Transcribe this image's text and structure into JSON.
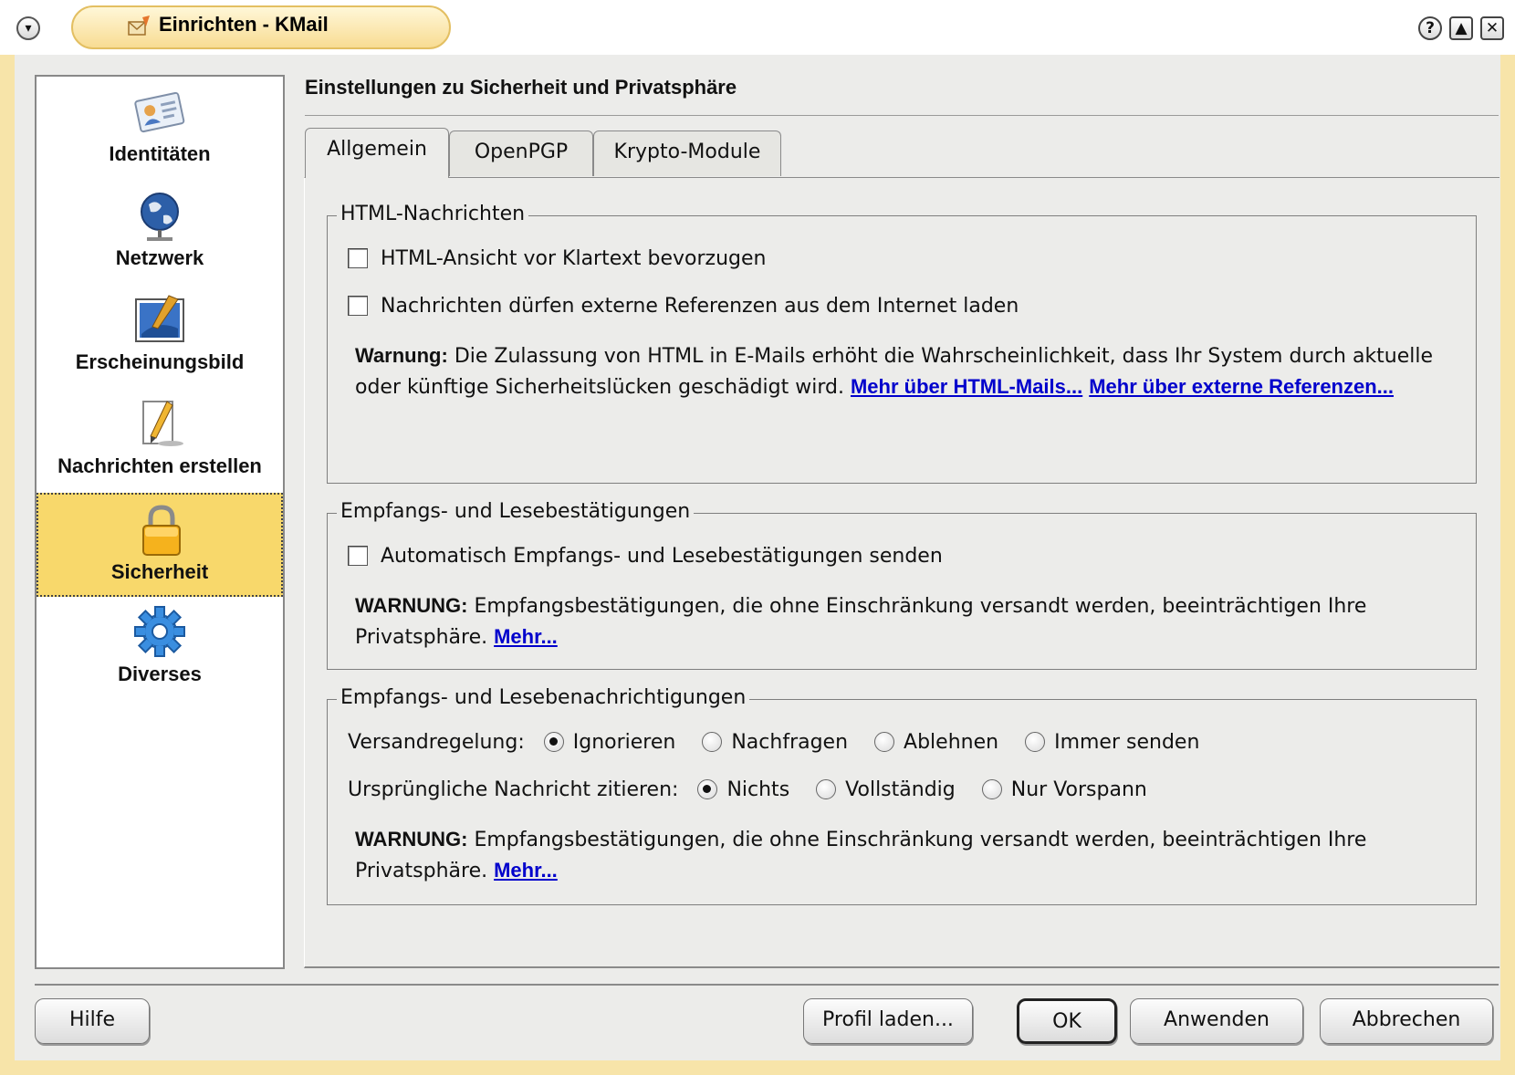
{
  "window": {
    "title": "Einrichten - KMail",
    "buttons": {
      "help": "?",
      "shade": "▲",
      "close": "✕"
    }
  },
  "sidebar": {
    "items": [
      {
        "label": "Identitäten",
        "icon": "identity-card-icon"
      },
      {
        "label": "Netzwerk",
        "icon": "globe-network-icon"
      },
      {
        "label": "Erscheinungsbild",
        "icon": "appearance-brush-icon"
      },
      {
        "label": "Nachrichten erstellen",
        "icon": "compose-pencil-icon"
      },
      {
        "label": "Sicherheit",
        "icon": "padlock-icon",
        "selected": true
      },
      {
        "label": "Diverses",
        "icon": "gear-icon"
      }
    ]
  },
  "page_title": "Einstellungen zu Sicherheit und Privatsphäre",
  "tabs": [
    {
      "label": "Allgemein",
      "active": true
    },
    {
      "label": "OpenPGP"
    },
    {
      "label": "Krypto-Module"
    }
  ],
  "html_group": {
    "title": "HTML-Nachrichten",
    "check_html": "HTML-Ansicht vor Klartext bevorzugen",
    "check_external": "Nachrichten dürfen externe Referenzen aus dem Internet laden",
    "warning_label": "Warnung:",
    "warning_line1": "Die Zulassung von HTML in E-Mails erhöht die Wahrscheinlichkeit, dass Ihr System durch aktuelle",
    "warning_line2": "oder künftige Sicherheitslücken geschädigt wird.",
    "link_html": "Mehr über HTML-Mails...",
    "link_external": "Mehr über externe Referenzen..."
  },
  "receipt_group": {
    "title": "Empfangs- und Lesebestätigungen",
    "check_auto": "Automatisch Empfangs- und Lesebestätigungen senden",
    "warning_label": "WARNUNG:",
    "warning_line1": "Empfangsbestätigungen, die ohne Einschränkung versandt werden, beeinträchtigen Ihre",
    "warning_line2": "Privatsphäre.",
    "link_more": "Mehr..."
  },
  "notification_group": {
    "title": "Empfangs- und Lesebenachrichtigungen",
    "policy_label": "Versandregelung:",
    "policy_options": [
      "Ignorieren",
      "Nachfragen",
      "Ablehnen",
      "Immer senden"
    ],
    "policy_selected": "Ignorieren",
    "quote_label": "Ursprüngliche Nachricht zitieren:",
    "quote_options": [
      "Nichts",
      "Vollständig",
      "Nur Vorspann"
    ],
    "quote_selected": "Nichts",
    "warning_label": "WARNUNG:",
    "warning_line1": "Empfangsbestätigungen, die ohne Einschränkung versandt werden, beeinträchtigen Ihre",
    "warning_line2": "Privatsphäre.",
    "link_more": "Mehr..."
  },
  "buttons": {
    "help": "Hilfe",
    "load_profile": "Profil laden...",
    "ok": "OK",
    "apply": "Anwenden",
    "cancel": "Abbrechen"
  },
  "colors": {
    "accent": "#f8d86b",
    "link": "#0000cc",
    "frame": "#ececea"
  }
}
